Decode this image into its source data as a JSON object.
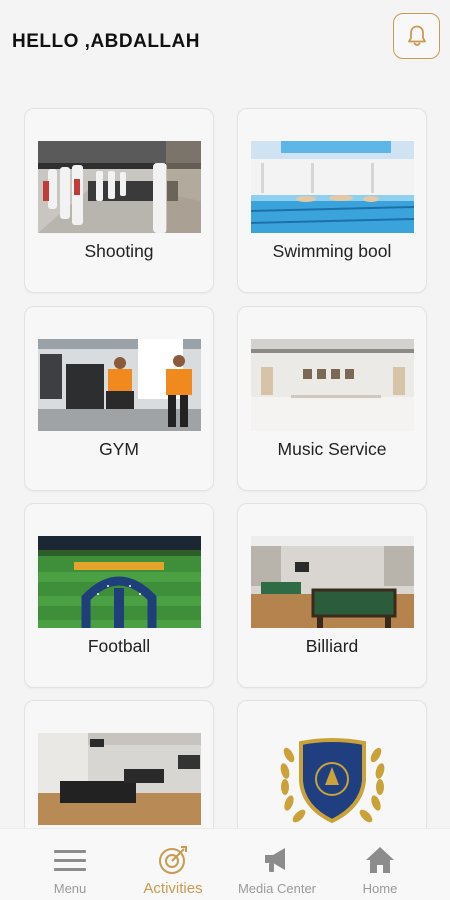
{
  "header": {
    "greeting": "HELLO ,ABDALLAH",
    "notification_icon": "bell-icon"
  },
  "activities": [
    {
      "label": "Shooting",
      "image": "shooting-range-photo"
    },
    {
      "label": "Swimming bool",
      "image": "swimming-pool-photo"
    },
    {
      "label": "GYM",
      "image": "gym-photo"
    },
    {
      "label": "Music Service",
      "image": "music-hall-photo"
    },
    {
      "label": "Football",
      "image": "football-field-photo"
    },
    {
      "label": "Billiard",
      "image": "billiard-room-photo"
    },
    {
      "label": "",
      "image": "foosball-room-photo"
    },
    {
      "label": "",
      "image": "emblem-logo"
    }
  ],
  "bottom_nav": {
    "items": [
      {
        "label": "Menu",
        "icon": "menu-icon"
      },
      {
        "label": "Activities",
        "icon": "activities-icon",
        "active": true
      },
      {
        "label": "Media Center",
        "icon": "megaphone-icon"
      },
      {
        "label": "Home",
        "icon": "home-icon"
      }
    ]
  },
  "colors": {
    "accent": "#c99a52",
    "background": "#f4f4f4",
    "card": "#f7f7f7",
    "inactive": "#9a9a9a"
  }
}
